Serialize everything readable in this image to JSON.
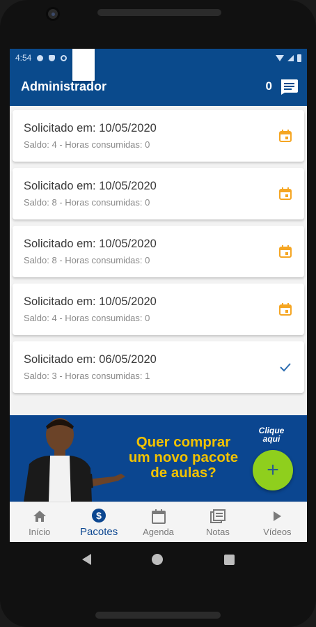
{
  "status_bar": {
    "time": "4:54",
    "left_icons": [
      "gear-icon",
      "shield-icon",
      "sync-icon",
      "sim-card-icon"
    ],
    "right_icons": [
      "wifi-icon",
      "signal-icon",
      "battery-icon"
    ]
  },
  "app_bar": {
    "title": "Administrador",
    "message_count": "0",
    "message_icon": "chat-icon"
  },
  "packages": [
    {
      "requested": "Solicitado em: 10/05/2020",
      "details": "Saldo: 4 - Horas consumidas: 0",
      "status_icon": "calendar-icon",
      "color": "#f5a623"
    },
    {
      "requested": "Solicitado em: 10/05/2020",
      "details": "Saldo: 8 - Horas consumidas: 0",
      "status_icon": "calendar-icon",
      "color": "#f5a623"
    },
    {
      "requested": "Solicitado em: 10/05/2020",
      "details": "Saldo: 8 - Horas consumidas: 0",
      "status_icon": "calendar-icon",
      "color": "#f5a623"
    },
    {
      "requested": "Solicitado em: 10/05/2020",
      "details": "Saldo: 4 - Horas consumidas: 0",
      "status_icon": "calendar-icon",
      "color": "#f5a623"
    },
    {
      "requested": "Solicitado em: 06/05/2020",
      "details": "Saldo: 3 - Horas consumidas: 1",
      "status_icon": "check-icon",
      "color": "#2b6cb0"
    }
  ],
  "banner": {
    "headline_lines": [
      "Quer comprar",
      "um novo pacote",
      "de aulas?"
    ],
    "cta_lines": [
      "Clique",
      "aqui"
    ],
    "fab_label": "+",
    "colors": {
      "background": "#0b4690",
      "headline": "#f2c200",
      "fab": "#8fcf1d"
    }
  },
  "bottom_nav": {
    "items": [
      {
        "label": "Início",
        "icon": "home-icon"
      },
      {
        "label": "Pacotes",
        "icon": "dollar-icon"
      },
      {
        "label": "Agenda",
        "icon": "calendar-icon"
      },
      {
        "label": "Notas",
        "icon": "notes-icon"
      },
      {
        "label": "Vídeos",
        "icon": "play-icon"
      }
    ],
    "active": "Pacotes"
  },
  "colors": {
    "primary": "#0a4a8c",
    "accent": "#f5a623"
  }
}
